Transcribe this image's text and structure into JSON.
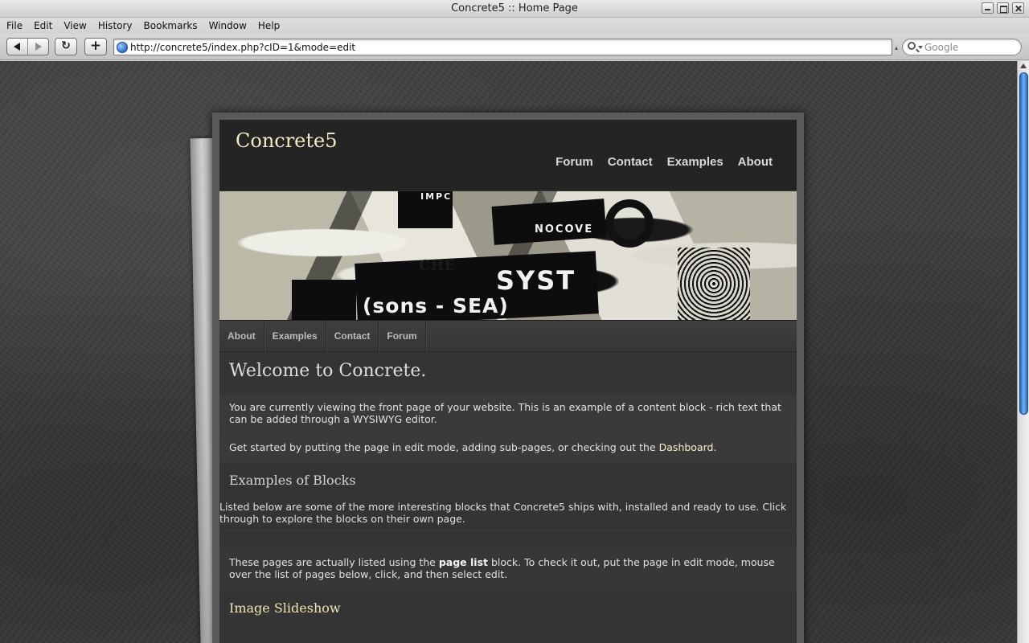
{
  "window": {
    "title": "Concrete5 :: Home Page"
  },
  "menubar": [
    "File",
    "Edit",
    "View",
    "History",
    "Bookmarks",
    "Window",
    "Help"
  ],
  "toolbar": {
    "url": "http://concrete5/index.php?cID=1&mode=edit",
    "search_placeholder": "Google"
  },
  "site": {
    "title": "Concrete5",
    "top_nav": [
      "Forum",
      "Contact",
      "Examples",
      "About"
    ],
    "banner_words": [
      "(sons - SEA)",
      "SYST",
      "NOCOVE",
      "CHE",
      "IMPC"
    ],
    "sub_nav": [
      "About",
      "Examples",
      "Contact",
      "Forum"
    ]
  },
  "content": {
    "heading": "Welcome to Concrete.",
    "intro": "You are currently viewing the front page of your website. This is an example of a content block - rich text that can be added through a WYSIWYG editor.",
    "get_started_prefix": "Get started by putting the page in edit mode, adding sub-pages, or checking out the ",
    "get_started_link": "Dashboard",
    "get_started_suffix": ".",
    "examples_heading": "Examples of Blocks",
    "examples_intro": "Listed below are some of the more interesting blocks that Concrete5 ships with, installed and ready to use. Click through to explore the blocks on their own page.",
    "page_list_prefix": "These pages are actually listed using the ",
    "page_list_bold": "page list",
    "page_list_suffix": " block. To check it out, put the page in edit mode, mouse over the list of pages below, click, and then select edit.",
    "slideshow_heading": "Image Slideshow"
  },
  "colors": {
    "site_title": "#f3ecc2",
    "link": "#f6efc4",
    "page_bg": "#343434",
    "scroll_thumb": "#2b6cc4"
  }
}
